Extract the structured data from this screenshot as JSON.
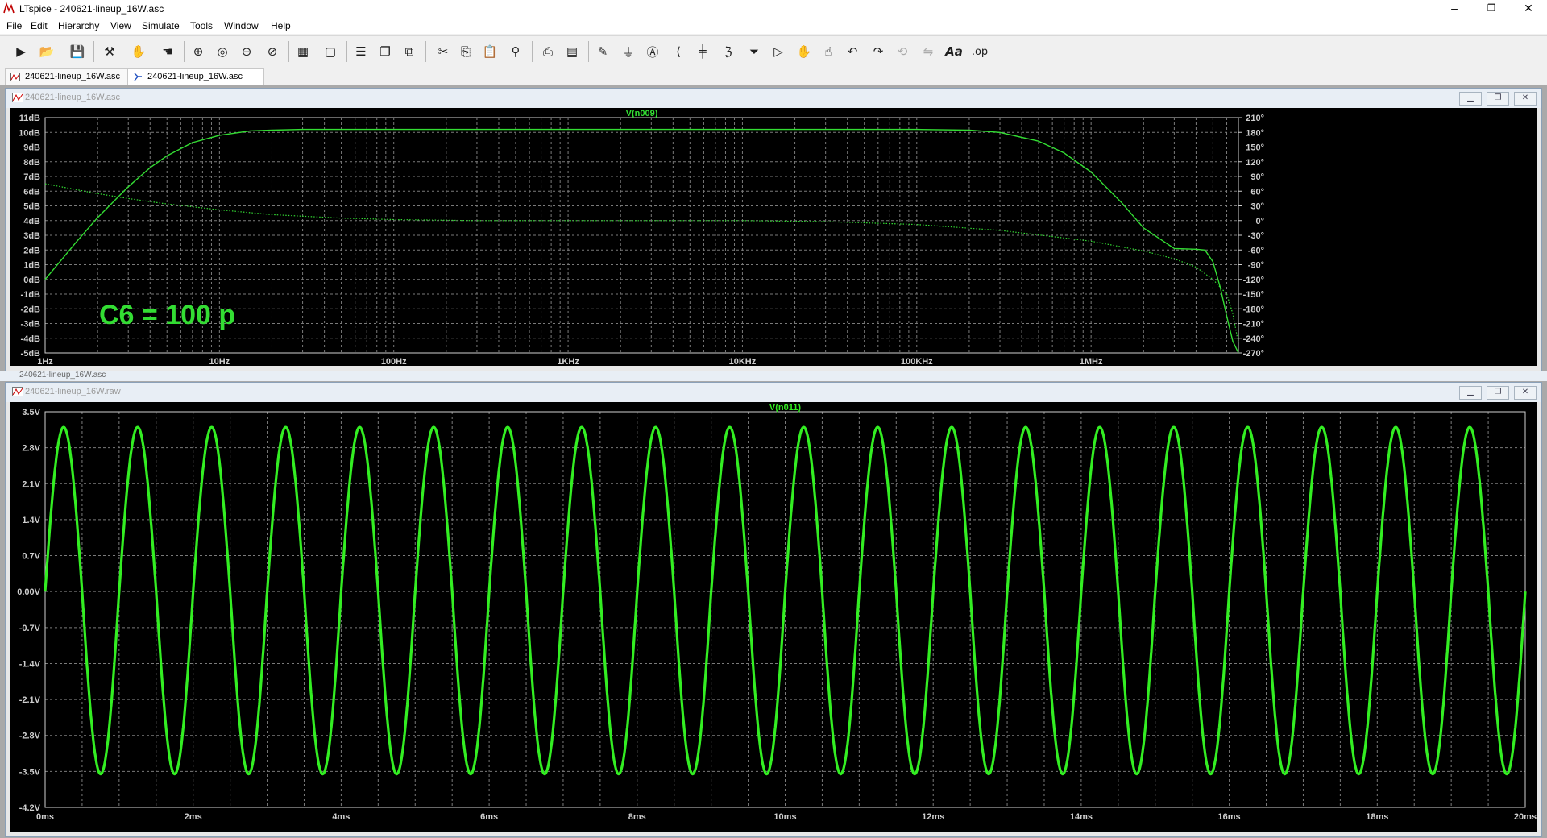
{
  "window": {
    "title": "LTspice - 240621-lineup_16W.asc",
    "minimize": "–",
    "maximize": "❐",
    "close": "✕"
  },
  "menu": [
    "File",
    "Edit",
    "Hierarchy",
    "View",
    "Simulate",
    "Tools",
    "Window",
    "Help"
  ],
  "toolbar_icons": [
    "run-icon",
    "open-icon",
    "save-icon",
    "control-panel-icon",
    "halt-icon",
    "pan-icon",
    "zoom-in-icon",
    "zoom-area-icon",
    "zoom-out-icon",
    "zoom-cancel-icon",
    "autorange-icon",
    "fit-icon",
    "tile-horizontal-icon",
    "cascade-icon",
    "tile-vertical-icon",
    "cut-icon",
    "copy-icon",
    "paste-icon",
    "find-icon",
    "print-icon",
    "print-setup-icon",
    "label-net-icon",
    "ground-icon",
    "label-icon",
    "resistor-icon",
    "capacitor-icon",
    "inductor-icon",
    "diode-icon",
    "component-icon",
    "move-icon",
    "drag-icon",
    "undo-icon",
    "redo-icon",
    "rotate-icon",
    "mirror-icon",
    "text-icon",
    "spice-directive-icon"
  ],
  "tabs": [
    {
      "label": "240621-lineup_16W.asc",
      "icon": "waveform-icon"
    },
    {
      "label": "240621-lineup_16W.asc",
      "icon": "schematic-icon"
    }
  ],
  "pane_top": {
    "title": "240621-lineup_16W.asc",
    "trace_label": "V(n009)",
    "annotation": "C6 = 100 p",
    "color": "#33dd33"
  },
  "pane_minimized": {
    "title": "240621-lineup_16W.asc"
  },
  "pane_bottom": {
    "title": "240621-lineup_16W.raw",
    "trace_label": "V(n011)",
    "color": "#33ee22"
  },
  "chart_data": [
    {
      "type": "line",
      "title": "V(n009)",
      "x_scale": "log",
      "x_tick_labels": [
        "1Hz",
        "10Hz",
        "100Hz",
        "1KHz",
        "10KHz",
        "100KHz",
        "1MHz"
      ],
      "xlim_hz": [
        1,
        7000000
      ],
      "y_left_tick_labels": [
        "11dB",
        "10dB",
        "9dB",
        "8dB",
        "7dB",
        "6dB",
        "5dB",
        "4dB",
        "3dB",
        "2dB",
        "1dB",
        "0dB",
        "-1dB",
        "-2dB",
        "-3dB",
        "-4dB",
        "-5dB"
      ],
      "y_left_lim_db": [
        -5,
        11
      ],
      "y_right_tick_labels": [
        "210°",
        "180°",
        "150°",
        "120°",
        "90°",
        "60°",
        "30°",
        "0°",
        "-30°",
        "-60°",
        "-90°",
        "-120°",
        "-150°",
        "-180°",
        "-210°",
        "-240°",
        "-270°"
      ],
      "y_right_lim_deg": [
        -270,
        210
      ],
      "grid": true,
      "series": [
        {
          "style": "solid",
          "axis": "left",
          "x": [
            1,
            1.5,
            2,
            3,
            4,
            5,
            7,
            10,
            15,
            20,
            30,
            50,
            100,
            1000,
            10000,
            50000,
            100000,
            200000,
            300000,
            500000,
            700000,
            1000000,
            1500000,
            2000000,
            3000000,
            4000000,
            4500000,
            5000000,
            5500000,
            6000000,
            6500000,
            7000000
          ],
          "y": [
            0,
            2.5,
            4.2,
            6.3,
            7.6,
            8.4,
            9.3,
            9.8,
            10.1,
            10.15,
            10.2,
            10.2,
            10.2,
            10.2,
            10.2,
            10.2,
            10.2,
            10.15,
            10.0,
            9.4,
            8.6,
            7.3,
            5.2,
            3.5,
            2.1,
            2.05,
            2.0,
            1.2,
            -0.5,
            -2.5,
            -4.2,
            -5.0
          ]
        },
        {
          "style": "dotted",
          "axis": "right",
          "x": [
            1,
            2,
            3,
            5,
            10,
            20,
            50,
            100,
            300,
            1000,
            10000,
            30000,
            100000,
            300000,
            1000000,
            2000000,
            3000000,
            4000000,
            5000000,
            6000000,
            6500000,
            7000000
          ],
          "y": [
            75,
            55,
            45,
            34,
            22,
            12,
            5,
            2,
            0,
            0,
            0,
            -2,
            -8,
            -20,
            -42,
            -62,
            -78,
            -95,
            -120,
            -150,
            -190,
            -250
          ]
        }
      ]
    },
    {
      "type": "line",
      "title": "V(n011)",
      "x_tick_labels": [
        "0ms",
        "2ms",
        "4ms",
        "6ms",
        "8ms",
        "10ms",
        "12ms",
        "14ms",
        "16ms",
        "18ms",
        "20ms"
      ],
      "xlim_ms": [
        0,
        20
      ],
      "y_tick_labels": [
        "3.5V",
        "2.8V",
        "2.1V",
        "1.4V",
        "0.7V",
        "0.00V",
        "-0.7V",
        "-1.4V",
        "-2.1V",
        "-2.8V",
        "-3.5V",
        "-4.2V"
      ],
      "ylim_v": [
        -4.2,
        3.5
      ],
      "grid": true,
      "series": [
        {
          "waveform": "sine",
          "frequency_hz": 1000,
          "peak_positive_v": 3.2,
          "peak_negative_v": -3.55,
          "start_phase_deg": 0,
          "x_start_ms": 0,
          "x_end_ms": 20
        }
      ]
    }
  ]
}
